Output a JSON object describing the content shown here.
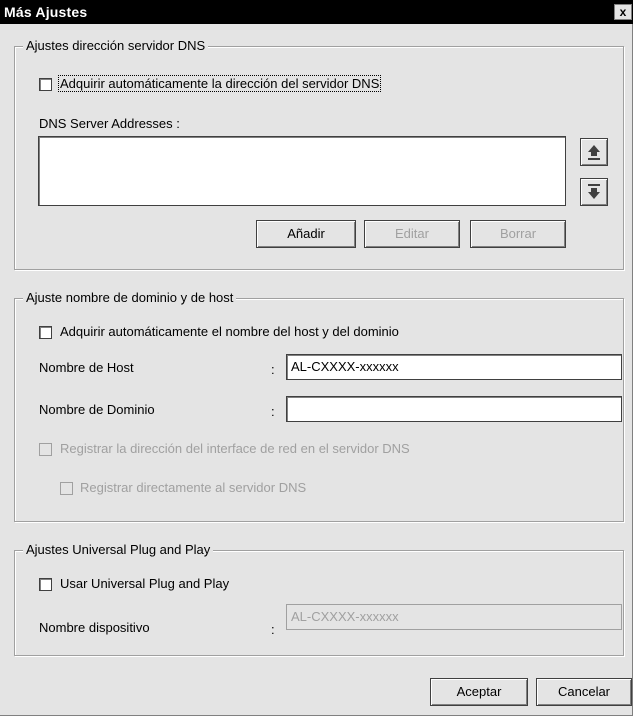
{
  "window": {
    "title": "Más Ajustes",
    "close_glyph": "x"
  },
  "dns": {
    "legend": "Ajustes dirección servidor DNS",
    "auto_label": "Adquirir automáticamente la dirección del servidor DNS",
    "auto_checked": false,
    "addresses_label": "DNS Server Addresses :",
    "addresses": [],
    "up_icon": "arrow-up-icon",
    "down_icon": "arrow-down-icon",
    "add_label": "Añadir",
    "edit_label": "Editar",
    "delete_label": "Borrar"
  },
  "host": {
    "legend": "Ajuste nombre de dominio y de host",
    "auto_label": "Adquirir automáticamente el nombre del host y del dominio",
    "auto_checked": false,
    "host_name_label": "Nombre de Host",
    "host_name_colon": ":",
    "host_name_value": "AL-CXXXX-xxxxxx",
    "domain_label": "Nombre de Dominio",
    "domain_colon": ":",
    "domain_value": "",
    "register_label": "Registrar la dirección del interface de red en el servidor DNS",
    "register_direct_label": "Registrar directamente al servidor DNS"
  },
  "upnp": {
    "legend": "Ajustes Universal Plug and Play",
    "use_label": "Usar Universal Plug and Play",
    "use_checked": false,
    "device_name_label": "Nombre dispositivo",
    "device_name_colon": ":",
    "device_name_value": "AL-CXXXX-xxxxxx"
  },
  "footer": {
    "ok_label": "Aceptar",
    "cancel_label": "Cancelar"
  }
}
